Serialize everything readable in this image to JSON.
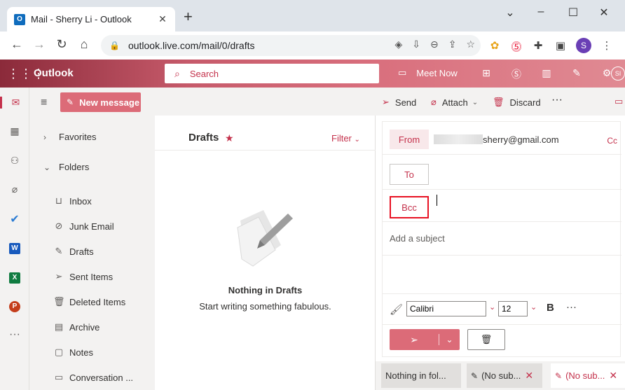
{
  "browser": {
    "tab_title": "Mail - Sherry Li - Outlook",
    "url": "outlook.live.com/mail/0/drafts",
    "profile_initial": "S",
    "accent": "#dfe4ea"
  },
  "header": {
    "brand": "Outlook",
    "search_placeholder": "Search",
    "meet_now": "Meet Now",
    "user_initials": "SI"
  },
  "rail": {
    "items": [
      "mail-icon",
      "calendar-icon",
      "people-icon",
      "attachment-icon",
      "todo-icon",
      "word-icon",
      "excel-icon",
      "powerpoint-icon",
      "more-apps-icon"
    ]
  },
  "folder_pane": {
    "new_message": "New message",
    "favorites": "Favorites",
    "folders": "Folders",
    "items": [
      {
        "label": "Inbox",
        "icon": "inbox-icon"
      },
      {
        "label": "Junk Email",
        "icon": "junk-icon"
      },
      {
        "label": "Drafts",
        "icon": "pencil-icon"
      },
      {
        "label": "Sent Items",
        "icon": "send-icon"
      },
      {
        "label": "Deleted Items",
        "icon": "trash-icon"
      },
      {
        "label": "Archive",
        "icon": "archive-icon"
      },
      {
        "label": "Notes",
        "icon": "note-icon"
      },
      {
        "label": "Conversation ...",
        "icon": "folder-icon"
      }
    ]
  },
  "command_bar": {
    "send": "Send",
    "attach": "Attach",
    "discard": "Discard"
  },
  "message_list": {
    "title": "Drafts",
    "filter": "Filter",
    "empty_title": "Nothing in Drafts",
    "empty_sub": "Start writing something fabulous."
  },
  "compose": {
    "from_label": "From",
    "from_address": "sherry@gmail.com",
    "cc_label": "Cc",
    "to_label": "To",
    "bcc_label": "Bcc",
    "subject_placeholder": "Add a subject",
    "font": "Calibri",
    "font_size": "12",
    "bold_label": "B"
  },
  "draft_tabs": [
    {
      "label": "Nothing in fol...",
      "active": false
    },
    {
      "label": "(No sub...",
      "active": false
    },
    {
      "label": "(No sub...",
      "active": true
    }
  ],
  "colors": {
    "brand": "#c4314b",
    "button": "#dc6b78",
    "highlight_border": "#e81123"
  }
}
